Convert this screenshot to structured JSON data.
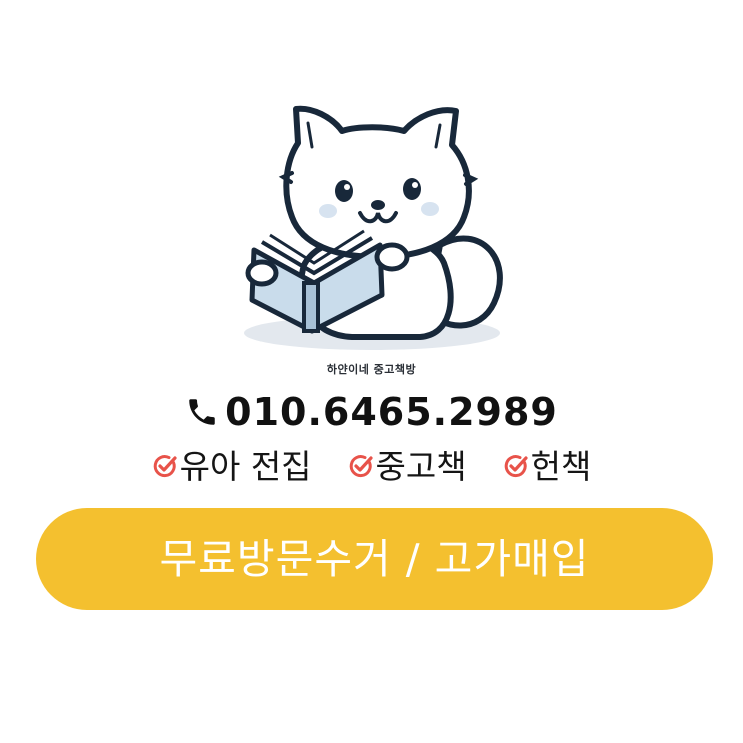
{
  "logo": {
    "shop_name": "하얀이네 중고책방",
    "icon": "white-dog-reading-book-icon"
  },
  "contact": {
    "icon": "phone-icon",
    "phone": "010.6465.2989"
  },
  "services": {
    "check_icon": "check-circle-icon",
    "check_color": "#e8534a",
    "items": [
      {
        "label": "유아 전집"
      },
      {
        "label": "중고책"
      },
      {
        "label": "헌책"
      }
    ]
  },
  "cta": {
    "label": "무료방문수거 / 고가매입",
    "color": "#f4c02f"
  }
}
